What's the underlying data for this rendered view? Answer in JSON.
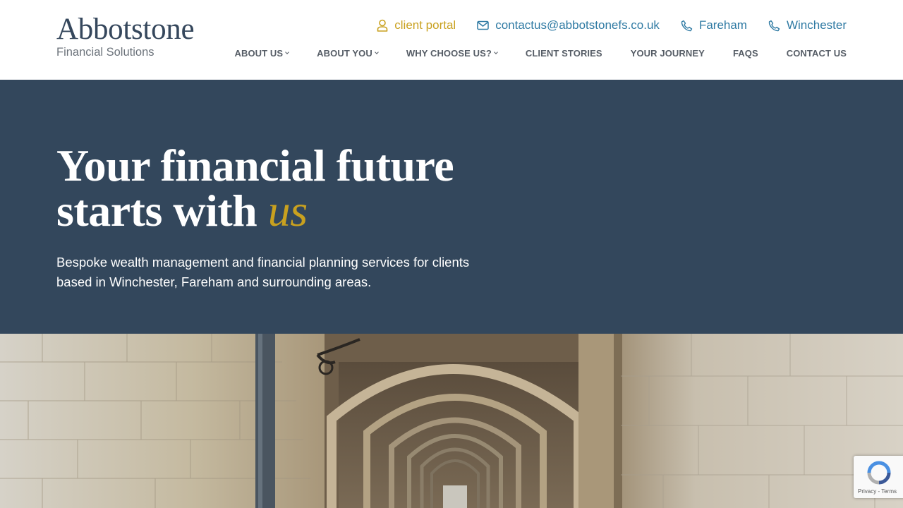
{
  "brand": {
    "name": "Abbotstone",
    "tagline": "Financial Solutions"
  },
  "contact_bar": {
    "portal": "client portal",
    "email": "contactus@abbotstonefs.co.uk",
    "phone_fareham": "Fareham",
    "phone_winchester": "Winchester"
  },
  "nav": {
    "items": [
      {
        "label": "ABOUT US",
        "dropdown": true
      },
      {
        "label": "ABOUT YOU",
        "dropdown": true
      },
      {
        "label": "WHY CHOOSE US?",
        "dropdown": true
      },
      {
        "label": "CLIENT STORIES",
        "dropdown": false
      },
      {
        "label": "YOUR JOURNEY",
        "dropdown": false
      },
      {
        "label": "FAQS",
        "dropdown": false
      },
      {
        "label": "CONTACT US",
        "dropdown": false
      }
    ]
  },
  "hero": {
    "title_line1": "Your financial future",
    "title_line2": "starts with",
    "title_accent": "us",
    "subtitle": "Bespoke wealth management and financial planning services for clients based in Winchester, Fareham and surrounding areas."
  },
  "recaptcha": {
    "privacy": "Privacy",
    "separator": " - ",
    "terms": "Terms"
  },
  "colors": {
    "hero_background": "#33475c",
    "accent_gold": "#c9a11f",
    "link_blue": "#2f7aa3",
    "nav_text": "#565d66"
  },
  "icons": {
    "portal": "user-icon",
    "email": "envelope-icon",
    "phone": "phone-icon",
    "recaptcha": "recaptcha-icon"
  }
}
